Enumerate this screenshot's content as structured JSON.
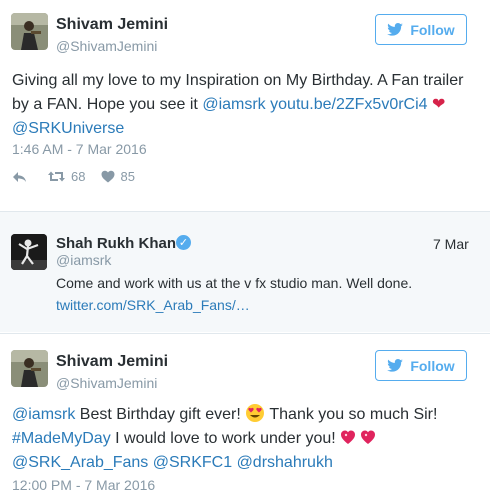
{
  "tweet1": {
    "name": "Shivam Jemini",
    "handle": "@ShivamJemini",
    "follow_label": "Follow",
    "text_part1": "Giving all my love to my Inspiration on My Birthday. A Fan trailer by a FAN. Hope you see it ",
    "mention1": "@iamsrk",
    "link": "youtu.be/2ZFx5v0rCi4",
    "mention2": "@SRKUniverse",
    "timestamp": "1:46 AM - 7 Mar 2016",
    "retweets": "68",
    "likes": "85"
  },
  "tweet2": {
    "name": "Shah Rukh Khan",
    "handle": "@iamsrk",
    "date": "7 Mar",
    "text": "Come and work with us at the v fx studio man. Well done.",
    "link": "twitter.com/SRK_Arab_Fans/…"
  },
  "tweet3": {
    "name": "Shivam Jemini",
    "handle": "@ShivamJemini",
    "follow_label": "Follow",
    "mention": "@iamsrk",
    "text_a": " Best Birthday gift ever! ",
    "text_b": " Thank you so much Sir!",
    "hashtag": "#MadeMyDay",
    "text_c": " I would love to work under you! ",
    "mentions_line": "@SRK_Arab_Fans @SRKFC1 @drshahrukh",
    "timestamp": "12:00 PM - 7 Mar 2016"
  },
  "colors": {
    "accent": "#55acee",
    "link": "#2b7bb9",
    "muted": "#8899a6",
    "heart": "#d6234a",
    "quoted_bg": "#f5f8fa"
  },
  "icons": [
    "twitter-bird-icon",
    "reply-icon",
    "retweet-icon",
    "heart-icon",
    "verified-icon",
    "heart-emoji-icon",
    "heart-eyes-emoji-icon",
    "sparkling-heart-emoji-icon"
  ]
}
